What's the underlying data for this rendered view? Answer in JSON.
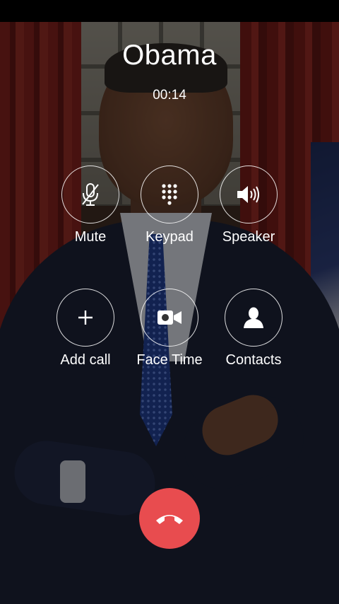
{
  "call": {
    "contact_name": "Obama",
    "duration": "00:14"
  },
  "actions": {
    "mute": {
      "label": "Mute",
      "icon": "mic-off-icon"
    },
    "keypad": {
      "label": "Keypad",
      "icon": "dialpad-icon"
    },
    "speaker": {
      "label": "Speaker",
      "icon": "speaker-icon"
    },
    "add_call": {
      "label": "Add call",
      "icon": "plus-icon"
    },
    "face_time": {
      "label": "Face Time",
      "icon": "video-camera-icon"
    },
    "contacts": {
      "label": "Contacts",
      "icon": "person-icon"
    }
  },
  "end_call": {
    "icon": "hang-up-icon",
    "color": "#e84c4f"
  },
  "colors": {
    "text": "#ffffff",
    "end_call": "#e84c4f",
    "status_bar": "#000000"
  }
}
